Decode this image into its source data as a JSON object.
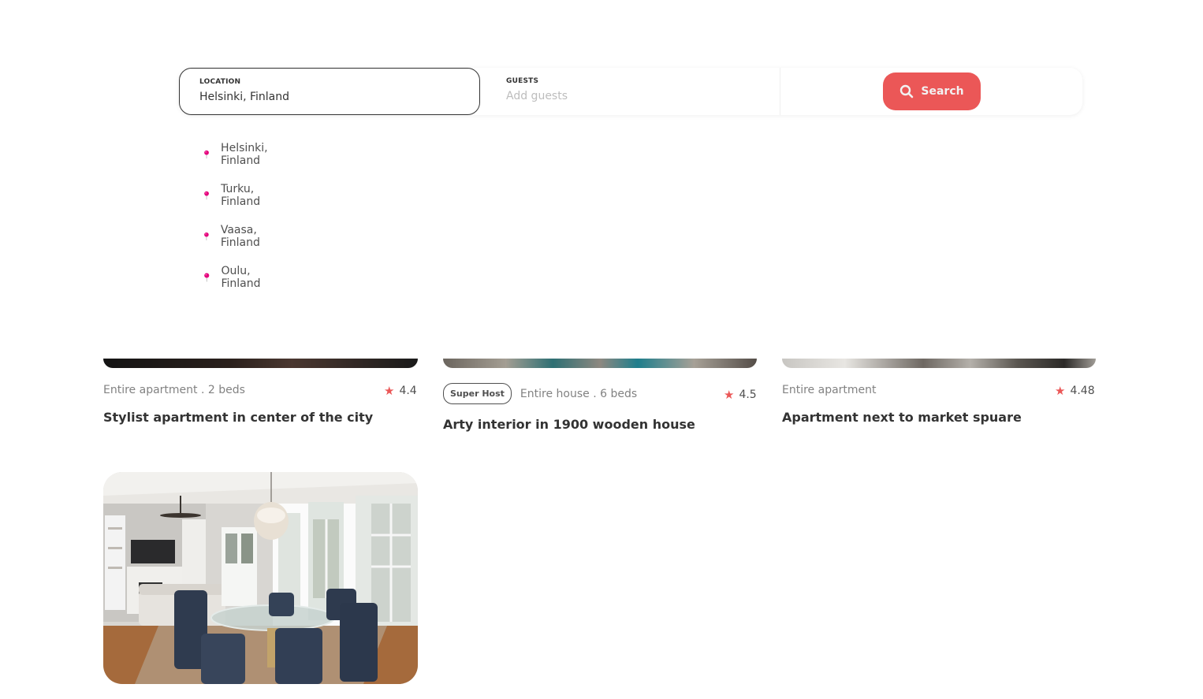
{
  "search": {
    "location_label": "LOCATION",
    "location_value": "Helsinki, Finland",
    "guests_label": "GUESTS",
    "guests_placeholder": "Add guests",
    "button_label": "Search"
  },
  "suggestions": [
    {
      "label": "Helsinki, Finland",
      "icon": "map-pin-icon"
    },
    {
      "label": "Turku, Finland",
      "icon": "map-pin-icon"
    },
    {
      "label": "Vaasa, Finland",
      "icon": "map-pin-icon"
    },
    {
      "label": "Oulu, Finland",
      "icon": "map-pin-icon"
    }
  ],
  "listings": [
    {
      "type": "Entire apartment . 2 beds",
      "rating": "4.4",
      "title": "Stylist apartment in center of the city",
      "superhost": false
    },
    {
      "type": "Entire house . 6 beds",
      "rating": "4.5",
      "title": "Arty interior in 1900 wooden house",
      "superhost": true,
      "badge": "Super Host"
    },
    {
      "type": "Entire apartment",
      "rating": "4.48",
      "title": "Apartment next to market spuare",
      "superhost": false
    }
  ],
  "colors": {
    "accent": "#eb5757",
    "pin": "#e4007c",
    "text": "#333333",
    "muted": "#828282"
  }
}
